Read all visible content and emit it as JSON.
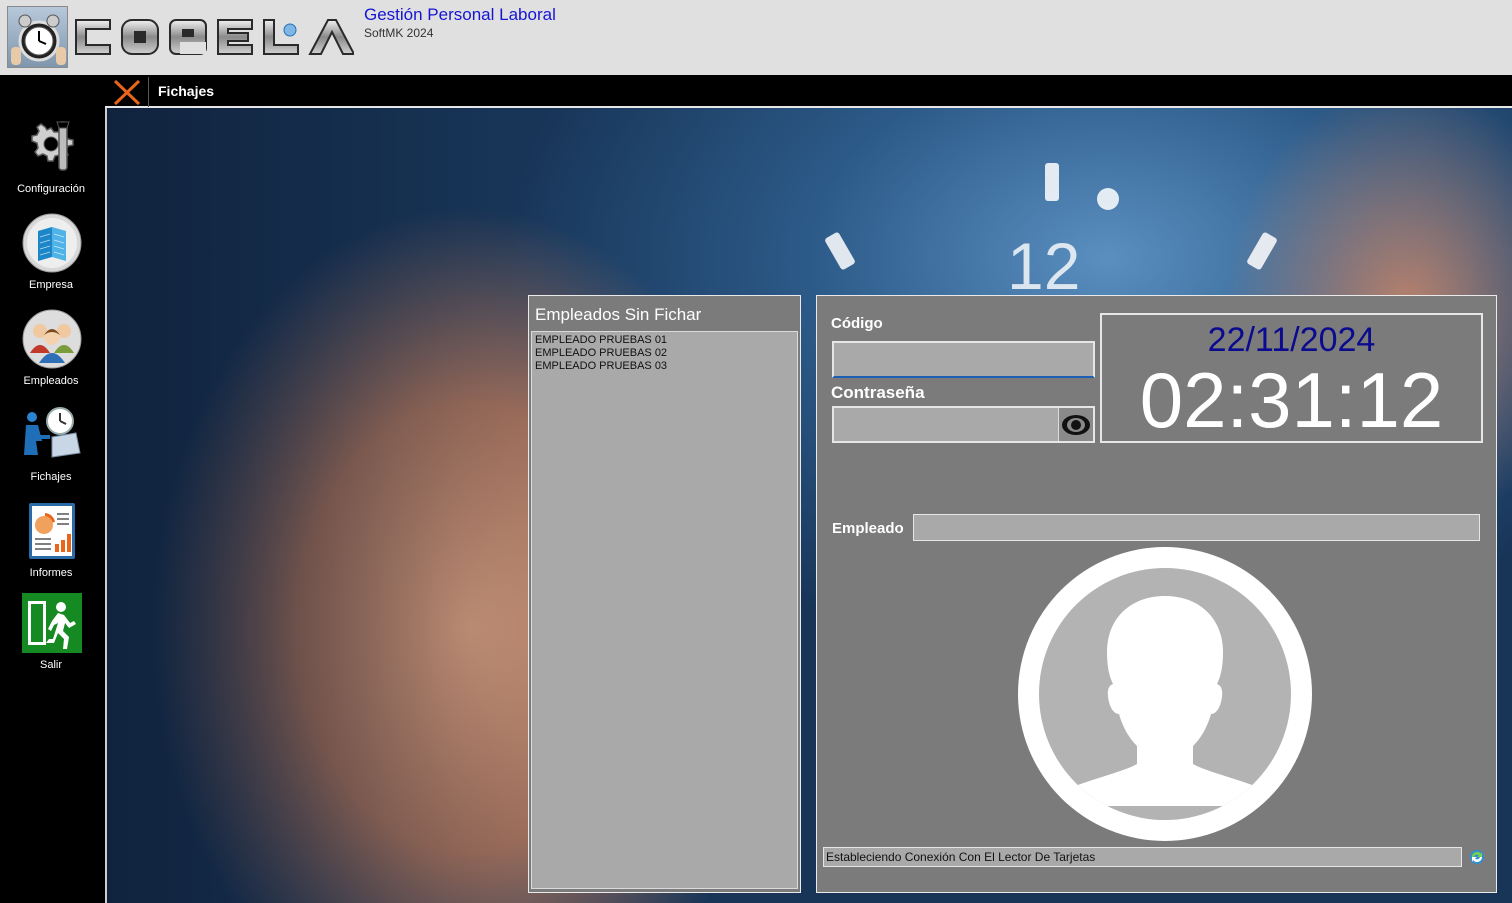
{
  "header": {
    "title": "Gestión Personal Laboral",
    "subtitle": "SoftMK 2024",
    "logo_text": "COPELA",
    "title_color": "#1515d4"
  },
  "sidebar": {
    "items": [
      {
        "label": "Configuración",
        "icon": "gear-wrench-icon"
      },
      {
        "label": "Empresa",
        "icon": "building-icon"
      },
      {
        "label": "Empleados",
        "icon": "people-icon"
      },
      {
        "label": "Fichajes",
        "icon": "clock-worker-icon"
      },
      {
        "label": "Informes",
        "icon": "report-icon"
      },
      {
        "label": "Salir",
        "icon": "exit-icon"
      }
    ]
  },
  "tab": {
    "label": "Fichajes",
    "close_icon": "close-icon",
    "close_color": "#e8651a"
  },
  "pending": {
    "title": "Empleados Sin Fichar",
    "items": [
      "EMPLEADO PRUEBAS 01",
      "EMPLEADO PRUEBAS 02",
      "EMPLEADO PRUEBAS 03"
    ]
  },
  "punch": {
    "codigo_label": "Código",
    "codigo_value": "",
    "password_label": "Contraseña",
    "password_value": "",
    "employee_label": "Empleado",
    "employee_value": "",
    "date": "22/11/2024",
    "time": "02:31:12",
    "status": "Estableciendo Conexión Con El Lector De Tarjetas",
    "date_color": "#0b0b8f"
  }
}
